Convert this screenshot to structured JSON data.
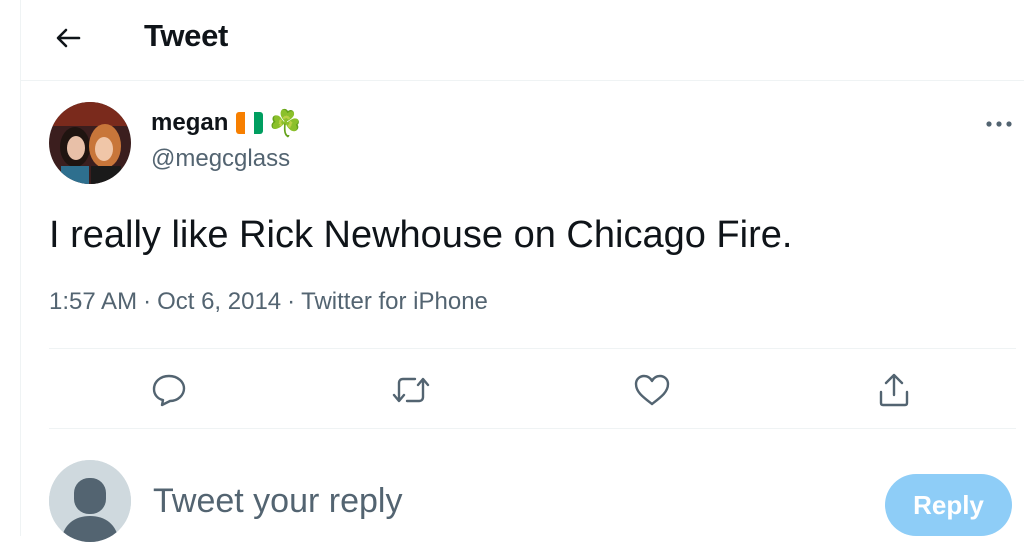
{
  "header": {
    "title": "Tweet",
    "back_icon": "arrow-left-icon"
  },
  "tweet": {
    "author_name": "megan",
    "author_flag_colors": [
      "#f77f00",
      "#ffffff",
      "#009e60"
    ],
    "author_emoji": "☘️",
    "handle": "@megcglass",
    "text": "I really like Rick Newhouse on Chicago Fire.",
    "time": "1:57 AM",
    "date": "Oct 6, 2014",
    "source": "Twitter for iPhone",
    "separator": "·"
  },
  "actions": [
    {
      "name": "reply",
      "icon": "comment-icon"
    },
    {
      "name": "retweet",
      "icon": "retweet-icon"
    },
    {
      "name": "like",
      "icon": "heart-icon"
    },
    {
      "name": "share",
      "icon": "share-icon"
    }
  ],
  "reply_box": {
    "placeholder": "Tweet your reply",
    "button_label": "Reply"
  },
  "colors": {
    "text": "#0f1419",
    "secondary": "#536471",
    "accent_disabled": "#8ecdf7",
    "divider": "#eff3f4"
  }
}
